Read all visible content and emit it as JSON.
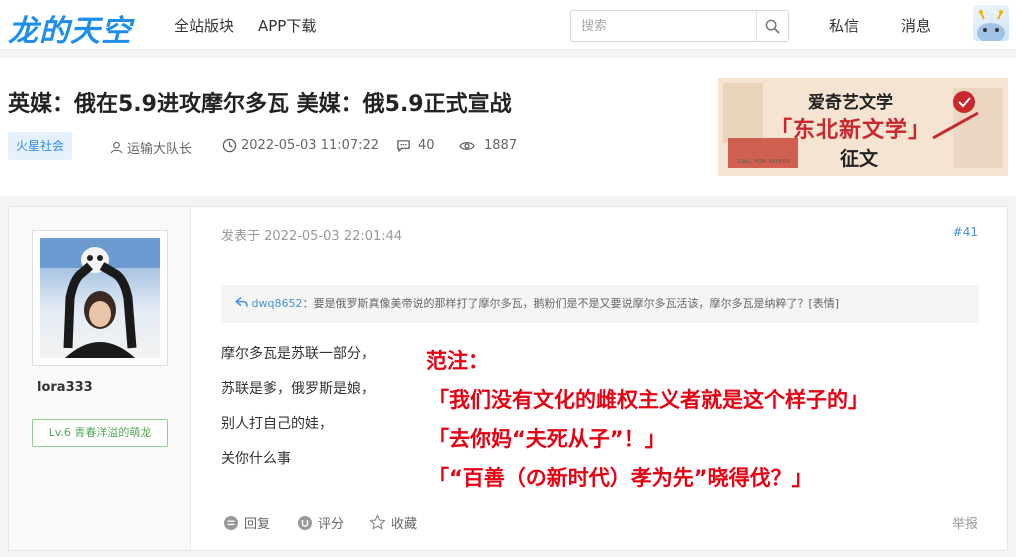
{
  "header": {
    "logo": "龙的天空",
    "nav": [
      "全站版块",
      "APP下载"
    ],
    "search_placeholder": "搜索",
    "messages": "私信",
    "notifications": "消息"
  },
  "thread": {
    "title": "英媒：俄在5.9进攻摩尔多瓦 美媒：俄5.9正式宣战",
    "forum": "火星社会",
    "author": "运输大队长",
    "datetime": "2022-05-03 11:07:22",
    "replies": "40",
    "views": "1887"
  },
  "banner": {
    "line1": "爱奇艺文学",
    "line2": "「东北新文学」",
    "line3": "征文",
    "small": "CALL FOR PAPERS"
  },
  "post": {
    "username": "lora333",
    "level": "Lv.6 青春洋溢的萌龙",
    "posted_at": "发表于 2022-05-03 22:01:44",
    "floor": "#41",
    "quote_user": "dwq8652",
    "quote_text": "：要是俄罗斯真像美帝说的那样打了摩尔多瓦，鹅粉们是不是又要说摩尔多瓦活该，摩尔多瓦是纳粹了？[表情]",
    "body_lines": [
      "摩尔多瓦是苏联一部分，",
      "苏联是爹，俄罗斯是娘，",
      "别人打自己的娃，",
      "关你什么事"
    ],
    "annotation": [
      "范注：",
      "「我们没有文化的雌权主义者就是这个样子的」",
      "「去你妈“夫死从子”！」",
      "「“百善（の新时代）孝为先”晓得伐？」"
    ],
    "actions": {
      "reply": "回复",
      "rate": "评分",
      "favorite": "收藏",
      "report": "举报"
    }
  }
}
